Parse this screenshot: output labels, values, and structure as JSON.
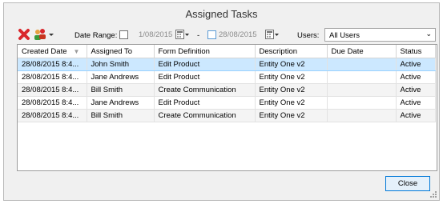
{
  "window": {
    "title": "Assigned Tasks"
  },
  "toolbar": {
    "icons": [
      "delete-icon",
      "assign-users-icon"
    ],
    "date_range_label": "Date Range:",
    "date_from": "1/08/2015",
    "date_separator": "-",
    "date_to": "28/08/2015",
    "users_label": "Users:",
    "users_value": "All Users"
  },
  "grid": {
    "columns": [
      "Created Date",
      "Assigned To",
      "Form Definition",
      "Description",
      "Due Date",
      "Status"
    ],
    "rows": [
      [
        "28/08/2015 8:4...",
        "John Smith",
        "Edit Product",
        "Entity One v2",
        "",
        "Active"
      ],
      [
        "28/08/2015 8:4...",
        "Jane Andrews",
        "Edit Product",
        "Entity One v2",
        "",
        "Active"
      ],
      [
        "28/08/2015 8:4...",
        "Bill Smith",
        "Create Communication",
        "Entity One v2",
        "",
        "Active"
      ],
      [
        "28/08/2015 8:4...",
        "Jane Andrews",
        "Edit Product",
        "Entity One v2",
        "",
        "Active"
      ],
      [
        "28/08/2015 8:4...",
        "Bill Smith",
        "Create Communication",
        "Entity One v2",
        "",
        "Active"
      ]
    ],
    "selected_row": 0
  },
  "footer": {
    "close_label": "Close"
  },
  "colors": {
    "selection": "#cce8ff",
    "accent": "#0078d7"
  }
}
